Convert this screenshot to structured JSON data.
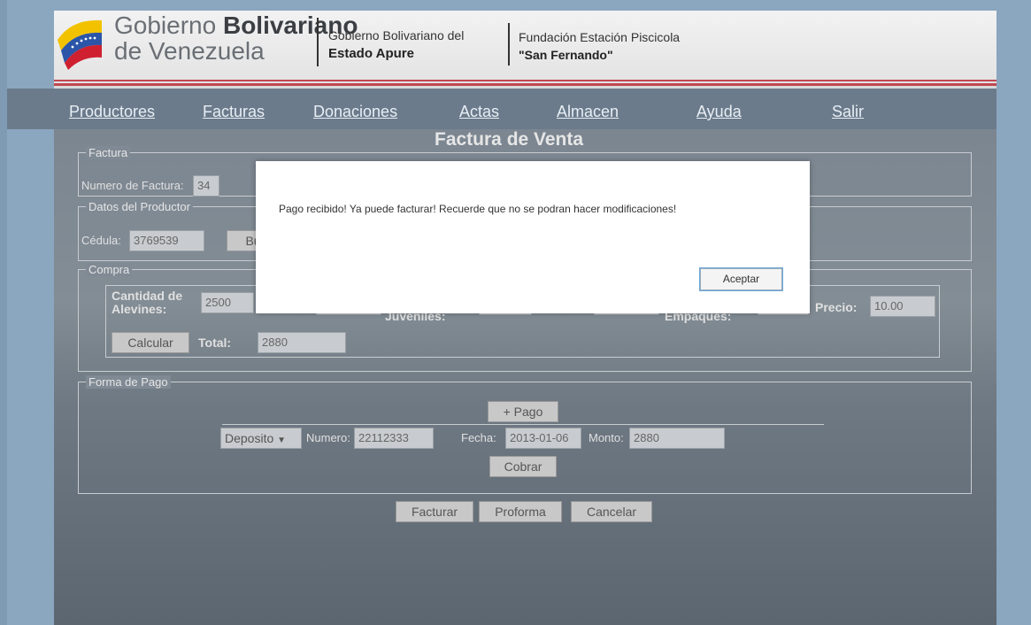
{
  "header": {
    "gob_line1_a": "Gobierno",
    "gob_line1_b": "Bolivariano",
    "gob_line2": "de Venezuela",
    "apure_line1": "Gobierno Bolivariano del",
    "apure_line2": "Estado Apure",
    "fund_line1": "Fundación Estación Piscicola",
    "fund_line2": "\"San Fernando\""
  },
  "nav": [
    {
      "label": "Productores"
    },
    {
      "label": "Facturas"
    },
    {
      "label": "Donaciones"
    },
    {
      "label": "Actas"
    },
    {
      "label": "Almacen"
    },
    {
      "label": "Ayuda"
    },
    {
      "label": "Salir"
    }
  ],
  "page_title": "Factura de Venta",
  "factura": {
    "legend": "Factura",
    "numero_label": "Numero de Factura:",
    "numero_value": "34"
  },
  "productor": {
    "legend": "Datos del Productor",
    "cedula_label": "Cédula:",
    "cedula_value": "3769539",
    "buscar_label": "Bu"
  },
  "compra": {
    "legend": "Compra",
    "cantidad_label_1": "Cantidad de",
    "cantidad_label_2": "Alevines:",
    "cantidad_value": "2500",
    "juveniles_label": "Juveniles:",
    "empaques_label": "Empaques:",
    "precio_label": "Precio:",
    "precio_value": "10.00",
    "calcular_label": "Calcular",
    "total_label": "Total:",
    "total_value": "2880"
  },
  "pago": {
    "legend": "Forma de Pago",
    "add_label": "+ Pago",
    "tipo_value": "Deposito",
    "numero_label": "Numero:",
    "numero_value": "22112333",
    "fecha_label": "Fecha:",
    "fecha_value": "2013-01-06",
    "monto_label": "Monto:",
    "monto_value": "2880",
    "cobrar_label": "Cobrar"
  },
  "actions": {
    "facturar": "Facturar",
    "proforma": "Proforma",
    "cancelar": "Cancelar"
  },
  "modal": {
    "message": "Pago recibido! Ya puede facturar! Recuerde que no se podran hacer modificaciones!",
    "accept": "Aceptar"
  },
  "colors": {
    "accent_red": "#c0474f",
    "nav_bg": "#6b7b8b"
  }
}
